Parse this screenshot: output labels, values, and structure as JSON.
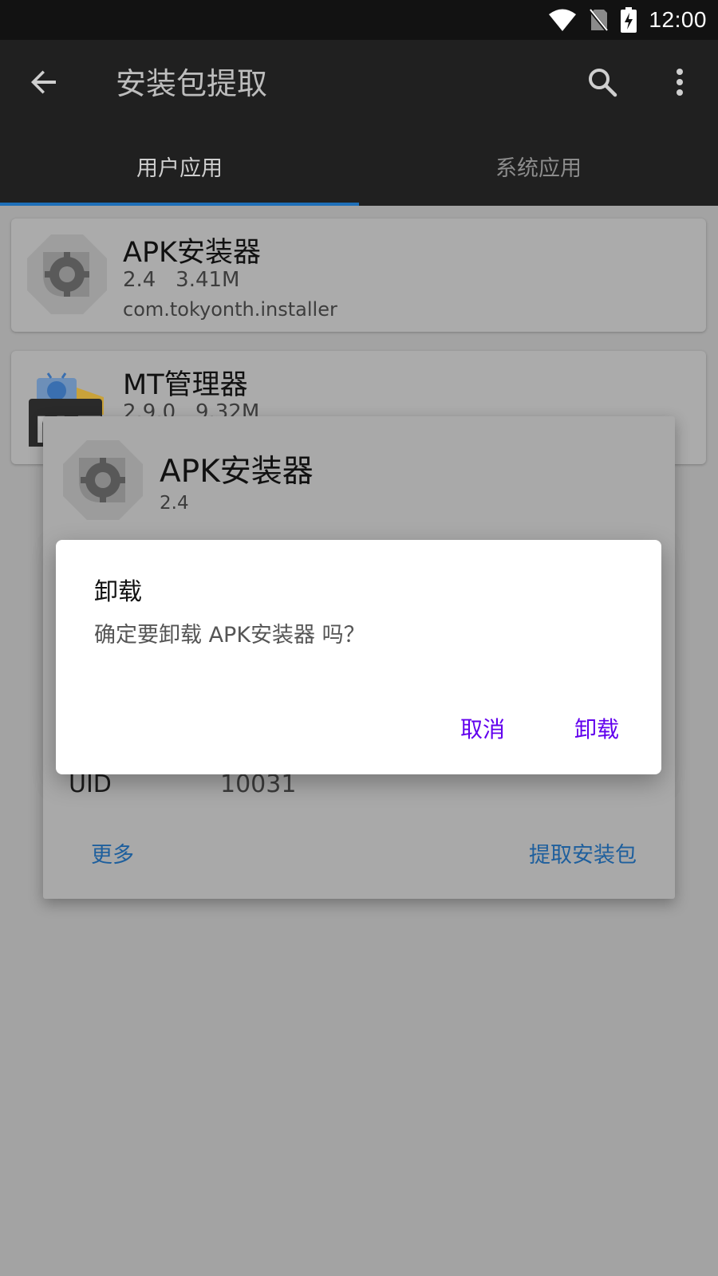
{
  "status_bar": {
    "time": "12:00"
  },
  "app_bar": {
    "title": "安装包提取"
  },
  "tabs": [
    {
      "label": "用户应用",
      "selected": true
    },
    {
      "label": "系统应用",
      "selected": false
    }
  ],
  "apps": [
    {
      "name": "APK安装器",
      "version": "2.4",
      "size": "3.41M",
      "package": "com.tokyonth.installer"
    },
    {
      "name": "MT管理器",
      "version": "2.9.0",
      "size": "9.32M"
    }
  ],
  "details": {
    "name": "APK安装器",
    "version": "2.4",
    "uid_label": "UID",
    "uid_value": "10031",
    "more_label": "更多",
    "extract_label": "提取安装包"
  },
  "dialog": {
    "title": "卸载",
    "message": "确定要卸载 APK安装器 吗？",
    "cancel_label": "取消",
    "confirm_label": "卸载"
  },
  "colors": {
    "accent_dialog": "#6200ee",
    "link": "#1e5f9d",
    "tab_indicator": "#1e6fb8",
    "app_bar": "#202020"
  },
  "icons": [
    "wifi-icon",
    "no-sim-icon",
    "battery-charging-icon",
    "back-arrow-icon",
    "search-icon",
    "more-vert-icon",
    "settings-gear-app-icon",
    "mt-manager-app-icon"
  ]
}
